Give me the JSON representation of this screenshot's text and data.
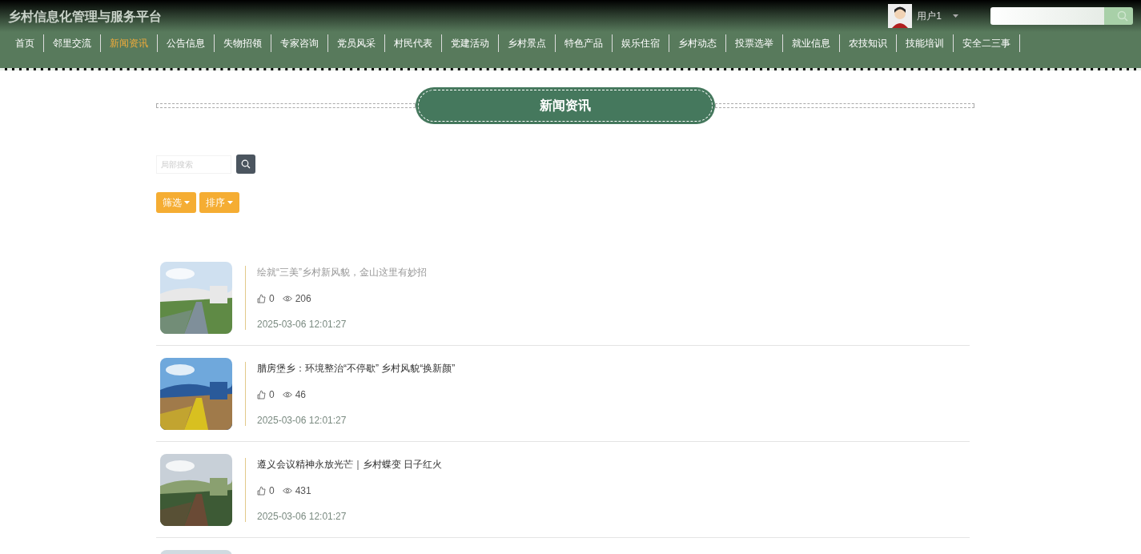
{
  "header": {
    "site_title": "乡村信息化管理与服务平台",
    "user": {
      "name": "用户1"
    }
  },
  "nav": [
    {
      "label": "首页",
      "selected": false
    },
    {
      "label": "邻里交流",
      "selected": false
    },
    {
      "label": "新闻资讯",
      "selected": true
    },
    {
      "label": "公告信息",
      "selected": false
    },
    {
      "label": "失物招领",
      "selected": false
    },
    {
      "label": "专家咨询",
      "selected": false
    },
    {
      "label": "党员风采",
      "selected": false
    },
    {
      "label": "村民代表",
      "selected": false
    },
    {
      "label": "党建活动",
      "selected": false
    },
    {
      "label": "乡村景点",
      "selected": false
    },
    {
      "label": "特色产品",
      "selected": false
    },
    {
      "label": "娱乐住宿",
      "selected": false
    },
    {
      "label": "乡村动态",
      "selected": false
    },
    {
      "label": "投票选举",
      "selected": false
    },
    {
      "label": "就业信息",
      "selected": false
    },
    {
      "label": "农技知识",
      "selected": false
    },
    {
      "label": "技能培训",
      "selected": false
    },
    {
      "label": "安全二三事",
      "selected": false
    }
  ],
  "page_title": "新闻资讯",
  "search": {
    "placeholder": "局部搜索"
  },
  "buttons": [
    "筛选",
    "排序"
  ],
  "news": [
    {
      "title": "绘就“三美”乡村新风貌，金山这里有妙招",
      "hovered": true,
      "likes": "0",
      "views": "206",
      "time": "2025-03-06 12:01:27",
      "kind": "article"
    },
    {
      "title": "腊房堡乡：环境整治“不停歇” 乡村风貌“换新颜”",
      "hovered": false,
      "likes": "0",
      "views": "46",
      "time": "2025-03-06 12:01:27",
      "kind": "article"
    },
    {
      "title": "遵义会议精神永放光芒｜乡村蝶变 日子红火",
      "hovered": false,
      "likes": "0",
      "views": "431",
      "time": "2025-03-06 12:01:27",
      "kind": "article"
    },
    {
      "kind": "picture"
    }
  ]
}
